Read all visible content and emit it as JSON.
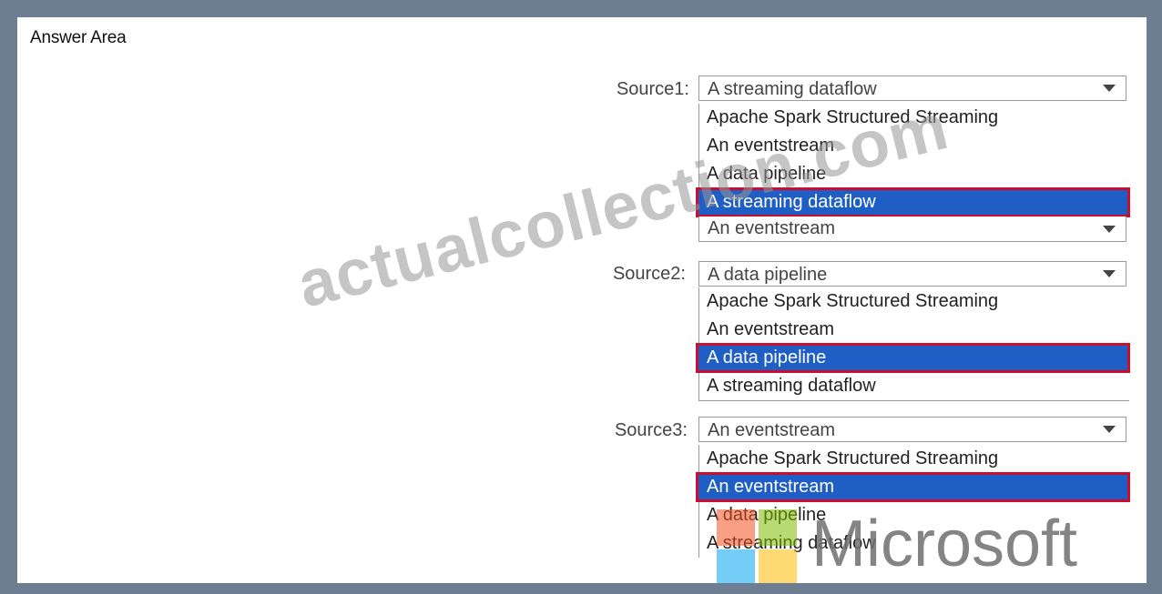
{
  "title": "Answer Area",
  "colors": {
    "frame": "#6d7e93",
    "selected_bg": "#1f5fc5",
    "highlight_border": "#c8102e"
  },
  "sources": [
    {
      "label": "Source1:",
      "selected": "A streaming dataflow",
      "options": [
        "Apache Spark Structured Streaming",
        "An eventstream",
        "A data pipeline",
        "A streaming dataflow"
      ],
      "highlighted": "A streaming dataflow"
    },
    {
      "label": "Source2:",
      "selected": "A data pipeline",
      "collapsed_value_above": "An eventstream",
      "options": [
        "Apache Spark Structured Streaming",
        "An eventstream",
        "A data pipeline",
        "A streaming dataflow"
      ],
      "highlighted": "A data pipeline"
    },
    {
      "label": "Source3:",
      "selected": "An eventstream",
      "options": [
        "Apache Spark Structured Streaming",
        "An eventstream",
        "A data pipeline",
        "A streaming dataflow"
      ],
      "highlighted": "An eventstream"
    }
  ],
  "watermark": "actualcollection.com",
  "logo_text": "Microsoft",
  "logo_colors": [
    "#f25022",
    "#7fba00",
    "#00a4ef",
    "#ffb900"
  ],
  "icons": {
    "dropdown": "chevron-down-icon"
  }
}
